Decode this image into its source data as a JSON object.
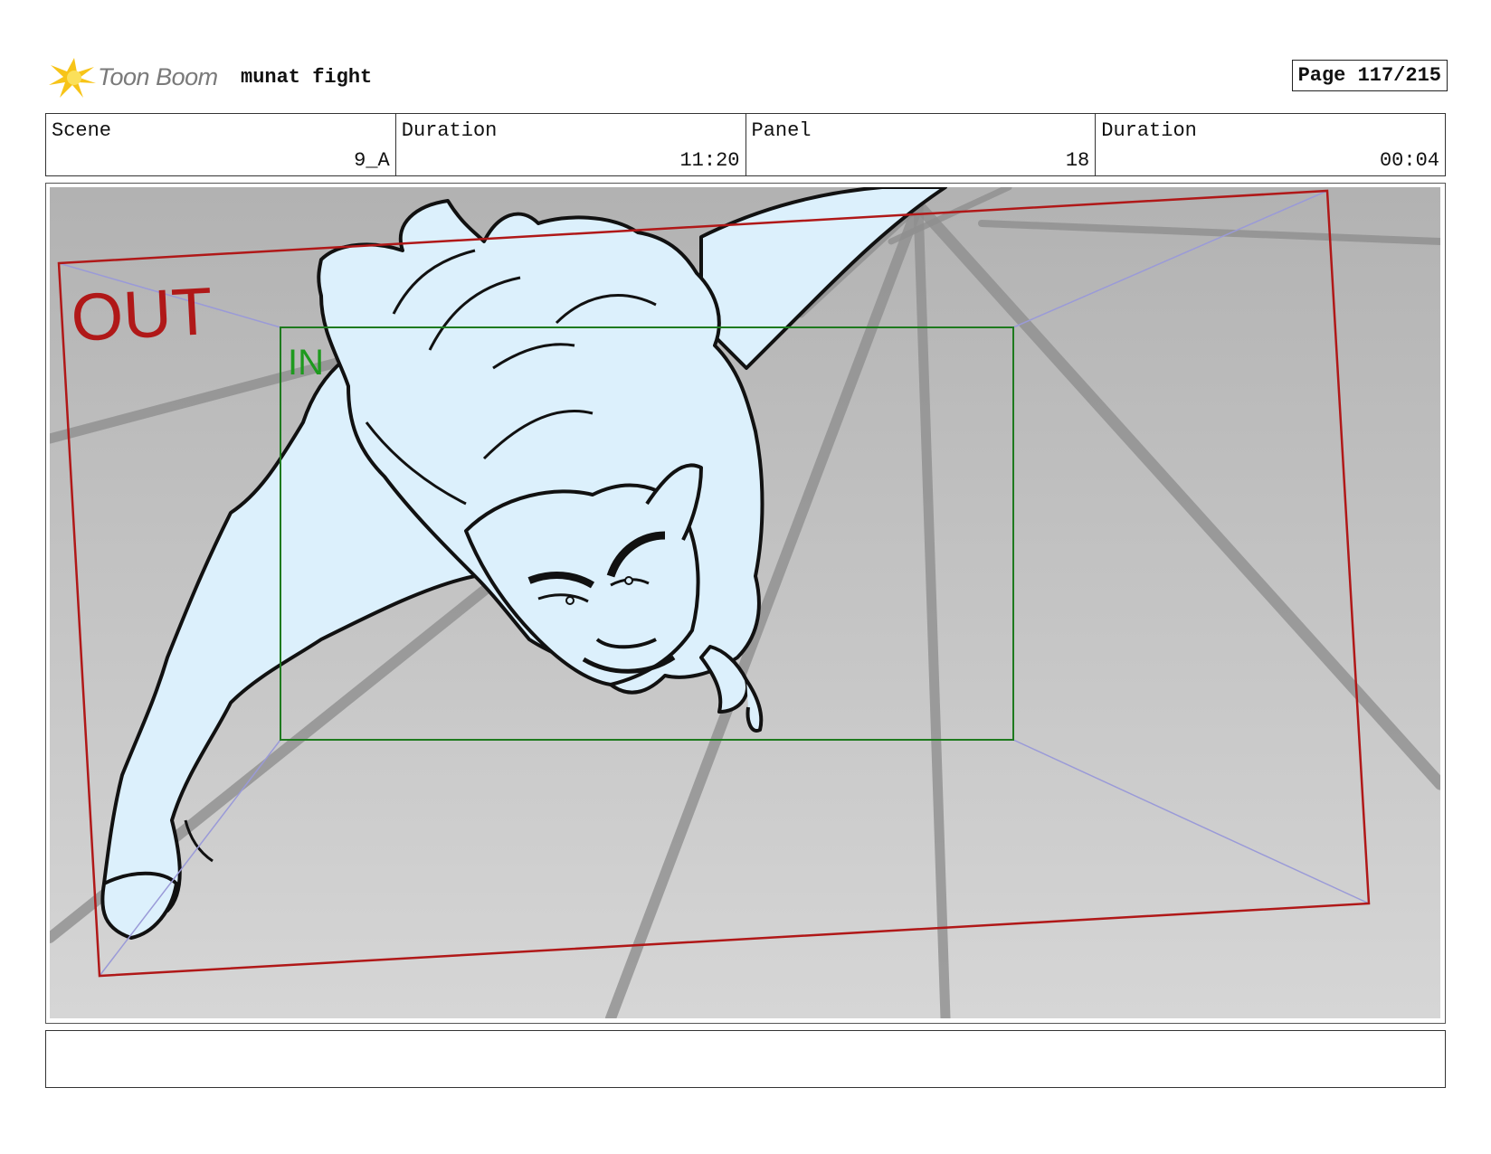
{
  "header": {
    "logo_text": "Toon Boom",
    "project_title": "munat fight",
    "page_label": "Page 117/215"
  },
  "info": {
    "scene_label": "Scene",
    "scene_value": "9_A",
    "scene_duration_label": "Duration",
    "scene_duration_value": "11:20",
    "panel_label": "Panel",
    "panel_value": "18",
    "panel_duration_label": "Duration",
    "panel_duration_value": "00:04"
  },
  "panel": {
    "out_label": "OUT",
    "in_label": "IN"
  },
  "notes": {
    "text": ""
  },
  "colors": {
    "out_frame": "#b01818",
    "in_frame": "#1e7a1e",
    "camera_guides": "#9a9ad8",
    "character_fill": "#dcf0fc"
  }
}
